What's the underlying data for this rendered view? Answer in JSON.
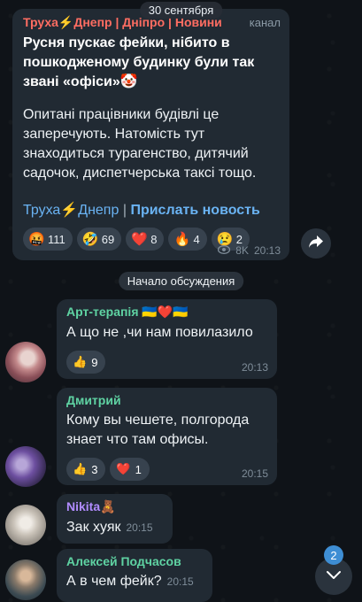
{
  "date_separator": "30 сентября",
  "post": {
    "author": "Труха⚡Днепр | Днiпро | Новини",
    "tag": "канал",
    "title": "Русня пускає фейки, нібито в пошкодженому будинку були так звані «офіси»🤡",
    "body": "Опитані працівники будівлі це заперечують. Натомість тут знаходиться турагенство, дитячий садочок, диспетчерська таксі тощо.",
    "link_channel": "Труха⚡Днепр",
    "link_separator": "|",
    "link_news": "Прислать новость",
    "reactions": [
      {
        "emoji": "🤬",
        "icon": "angry-face-icon",
        "count": "111"
      },
      {
        "emoji": "🤣",
        "icon": "rofl-face-icon",
        "count": "69"
      },
      {
        "emoji": "❤️",
        "icon": "heart-icon",
        "count": "8"
      },
      {
        "emoji": "🔥",
        "icon": "fire-icon",
        "count": "4"
      },
      {
        "emoji": "😢",
        "icon": "crying-face-icon",
        "count": "2"
      }
    ],
    "views": "8K",
    "time": "20:13"
  },
  "discussion_label": "Начало обсуждения",
  "comments": [
    {
      "author": "Арт-терапія 🇺🇦❤️🇺🇦",
      "author_color": "#5fd3a3",
      "text": "А що не ,чи нам повилазило",
      "reactions": [
        {
          "emoji": "👍",
          "count": "9"
        }
      ],
      "time": "20:13"
    },
    {
      "author": "Дмитрий",
      "author_color": "#5fd3a3",
      "text": "Кому вы чешете, полгорода знает что там офисы.",
      "reactions": [
        {
          "emoji": "👍",
          "count": "3"
        },
        {
          "emoji": "❤️",
          "count": "1"
        }
      ],
      "time": "20:15"
    },
    {
      "author": "Nikita🧸",
      "author_color": "#b18cff",
      "text": "Зак хуяк",
      "time": "20:15"
    },
    {
      "author": "Алексей Подчасов",
      "author_color": "#5fd3a3",
      "text": "А в чем фейк?",
      "time": "20:15"
    }
  ],
  "unread_count": "2",
  "colors": {
    "bubble": "#212a33",
    "link": "#6ab3f3",
    "accent": "#3e8ed4",
    "channel_name": "#ff6d62"
  }
}
